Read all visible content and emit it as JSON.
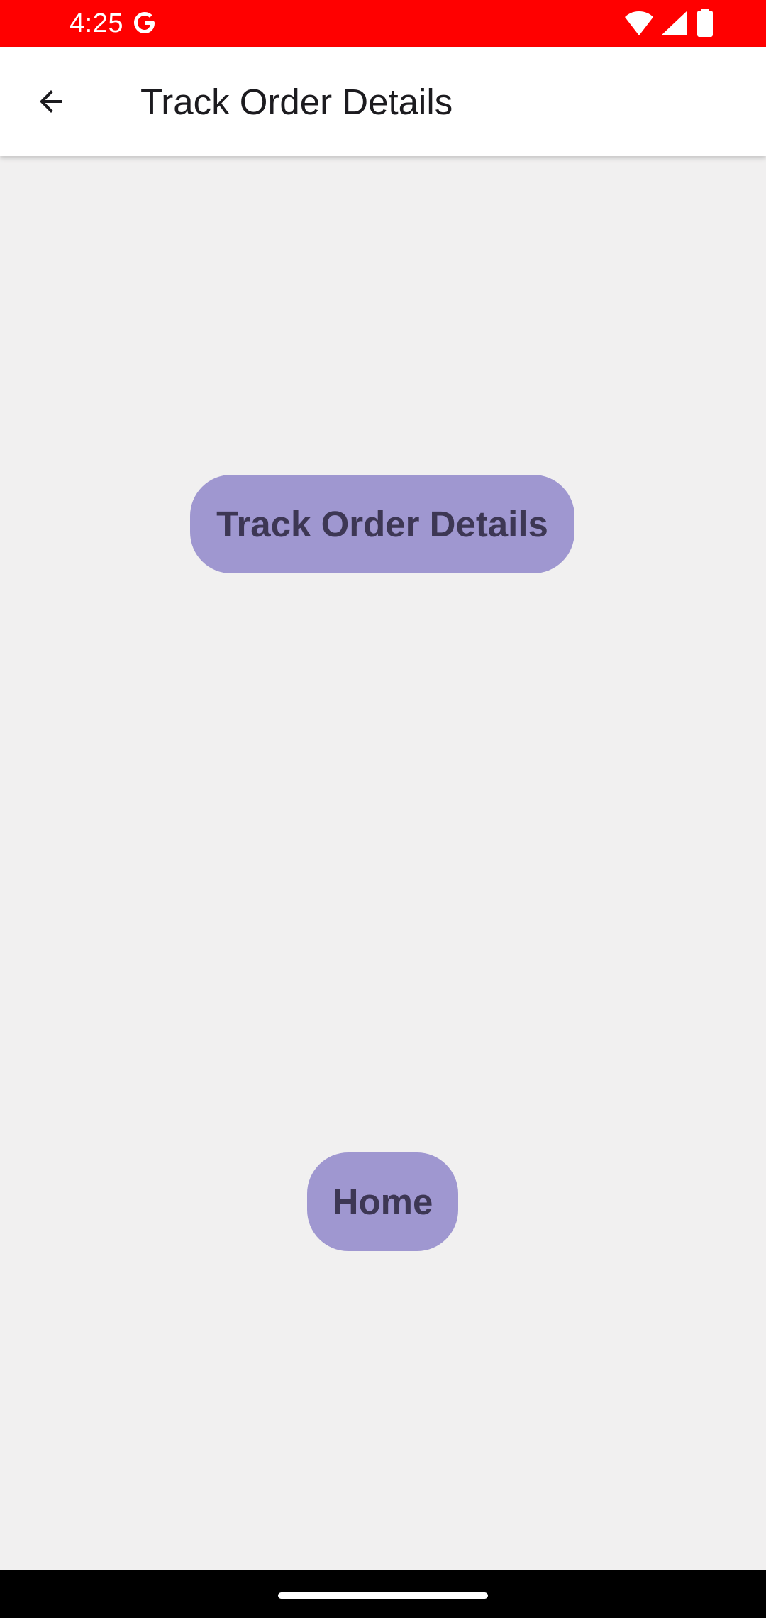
{
  "status_bar": {
    "time": "4:25",
    "background_color": "#ff0000",
    "icons": [
      "google-g-icon",
      "wifi-icon",
      "signal-icon",
      "battery-icon"
    ]
  },
  "app_bar": {
    "back_icon": "arrow-back-icon",
    "title": "Track Order Details"
  },
  "main": {
    "track_button_label": "Track Order Details",
    "home_button_label": "Home",
    "button_color": "#9f97d0",
    "button_text_color": "#3d3754"
  }
}
